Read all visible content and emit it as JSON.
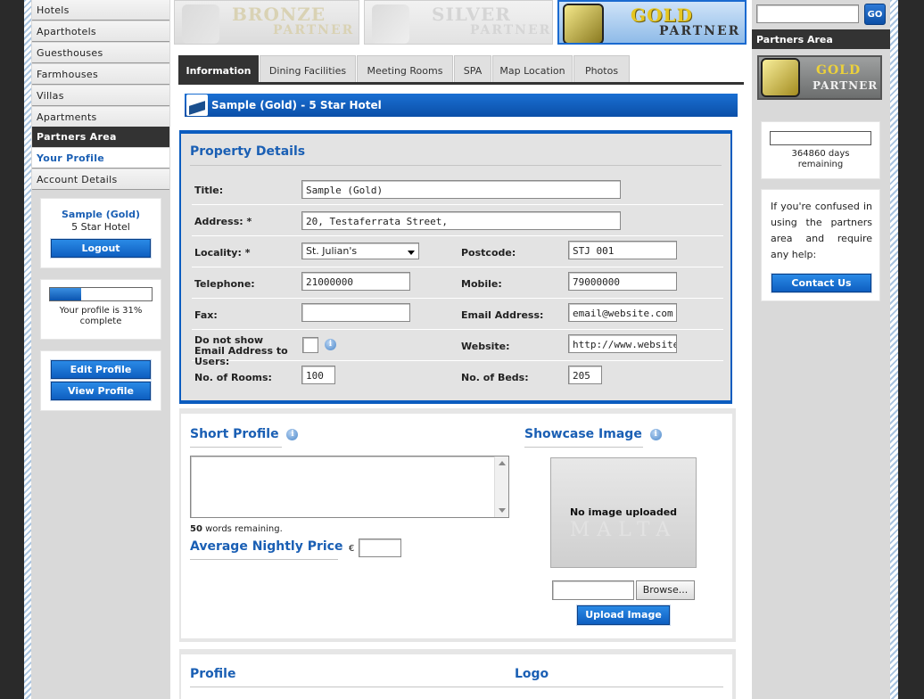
{
  "sidebar": {
    "nav": [
      "Hotels",
      "Aparthotels",
      "Guesthouses",
      "Farmhouses",
      "Villas",
      "Apartments"
    ],
    "section_title": "Partners Area",
    "partner_links": [
      "Your Profile",
      "Account Details"
    ],
    "user_name": "Sample (Gold)",
    "user_type": "5 Star Hotel",
    "logout_label": "Logout",
    "profile_progress": 0.31,
    "profile_text": "Your profile is 31% complete",
    "edit_profile_label": "Edit Profile",
    "view_profile_label": "View Profile"
  },
  "banners": [
    {
      "word": "BRONZE",
      "sub": "PARTNER"
    },
    {
      "word": "SILVER",
      "sub": "PARTNER"
    },
    {
      "word": "GOLD",
      "sub": "PARTNER"
    }
  ],
  "tabs": [
    "Information",
    "Dining Facilities",
    "Meeting Rooms",
    "SPA",
    "Map Location",
    "Photos"
  ],
  "header_bar": "Sample (Gold) - 5 Star Hotel",
  "property": {
    "title": "Property Details",
    "labels": {
      "title": "Title:",
      "address": "Address: *",
      "locality": "Locality: *",
      "postcode": "Postcode:",
      "telephone": "Telephone:",
      "mobile": "Mobile:",
      "fax": "Fax:",
      "email": "Email Address:",
      "hide_email": "Do not show Email Address to Users:",
      "website": "Website:",
      "rooms": "No. of Rooms:",
      "beds": "No. of Beds:"
    },
    "values": {
      "title": "Sample (Gold)",
      "address": "20, Testaferrata Street,",
      "locality": "St. Julian's",
      "postcode": "STJ 001",
      "telephone": "21000000",
      "mobile": "79000000",
      "fax": "",
      "email": "email@website.com",
      "website": "http://www.website.com",
      "rooms": "100",
      "beds": "205"
    }
  },
  "short_profile": {
    "title": "Short Profile",
    "words_count": "50",
    "words_text": " words remaining.",
    "price_title": "Average Nightly Price",
    "currency": "€",
    "price_value": ""
  },
  "showcase": {
    "title": "Showcase Image",
    "no_image": "No image uploaded",
    "watermark": "MALTA",
    "browse_label": "Browse...",
    "upload_label": "Upload Image"
  },
  "bottom": {
    "profile_title": "Profile",
    "logo_title": "Logo"
  },
  "right": {
    "go_label": "GO",
    "section_title": "Partners Area",
    "badge_word": "GOLD",
    "badge_sub": "PARTNER",
    "days_text": "364860 days remaining",
    "help_text": "If you're confused in using the partners area and require any help:",
    "contact_label": "Contact Us"
  },
  "colors": {
    "accent_blue": "#0b5cbf",
    "title_blue": "#1a5fb4",
    "dark_bar": "#333333"
  }
}
